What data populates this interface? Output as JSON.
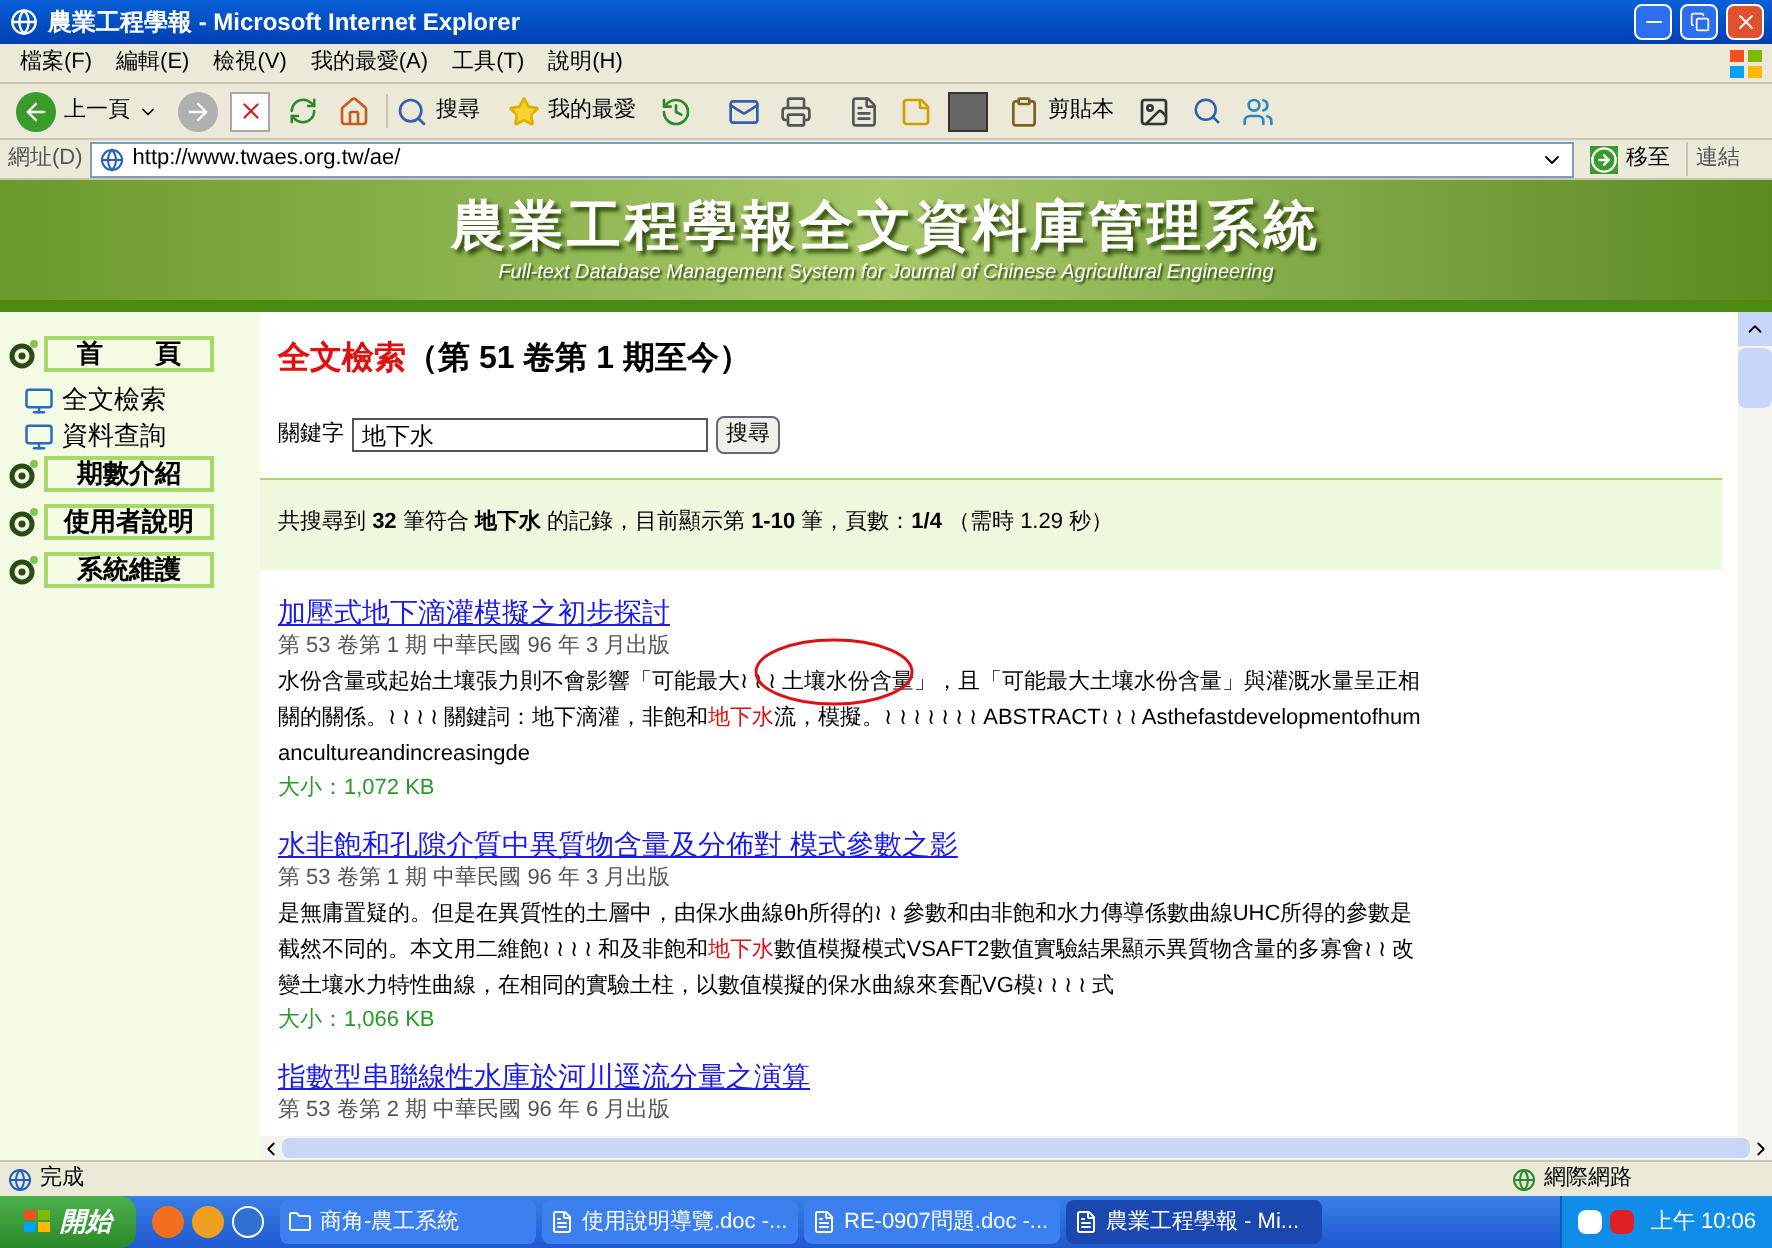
{
  "window": {
    "title": "農業工程學報 - Microsoft Internet Explorer"
  },
  "menu": [
    "檔案(F)",
    "編輯(E)",
    "檢視(V)",
    "我的最愛(A)",
    "工具(T)",
    "說明(H)"
  ],
  "toolbar": {
    "back": "上一頁",
    "search": "搜尋",
    "favorites": "我的最愛",
    "clipboard": "剪貼本"
  },
  "address_bar": {
    "label": "網址(D)",
    "url": "http://www.twaes.org.tw/ae/",
    "go": "移至",
    "links": "連結"
  },
  "banner": {
    "title": "農業工程學報全文資料庫管理系統",
    "subtitle": "Full-text Database Management System for Journal of Chinese Agricultural Engineering"
  },
  "sidebar": {
    "items": [
      {
        "kind": "section",
        "label": "首　　頁"
      },
      {
        "kind": "link",
        "label": "全文檢索"
      },
      {
        "kind": "link",
        "label": "資料查詢"
      },
      {
        "kind": "section",
        "label": "期數介紹"
      },
      {
        "kind": "section",
        "label": "使用者說明"
      },
      {
        "kind": "section",
        "label": "系統維護"
      }
    ]
  },
  "heading": {
    "highlight": "全文檢索",
    "rest": "（第 51 卷第 1 期至今）"
  },
  "search": {
    "label": "關鍵字",
    "value": "地下水",
    "button": "搜尋"
  },
  "summary": "共搜尋到 **32** 筆符合 **地下水** 的記錄，目前顯示第 **1-10** 筆，頁數：**1/4** （需時 1.29 秒）",
  "results": [
    {
      "title": "加壓式地下滴灌模擬之初步探討",
      "meta": "第 53 卷第 1 期 中華民國 96 年 3 月出版",
      "circled": true,
      "snippet": [
        {
          "text": "水份含量或起始土壤張力則不會影響「可能最大≀ ≀ ≀ 土壤水份含量」，且「可能最大土壤水份含量」與灌溉水量呈正相關的關係。≀ ≀ ≀ ≀ 關鍵詞：地下滴灌，非飽和",
          "highlight": false
        },
        {
          "text": "地下水",
          "highlight": true
        },
        {
          "text": "流，模擬。≀ ≀ ≀ ≀ ≀ ≀ ≀ ABSTRACT≀ ≀ ≀ Asthefastdevelopmentofhumancultureandincreasingde",
          "highlight": false
        }
      ],
      "size": "大小：1,072 KB"
    },
    {
      "title": "水非飽和孔隙介質中異質物含量及分佈對 模式參數之影",
      "meta": "第 53 卷第 1 期 中華民國 96 年 3 月出版",
      "circled": false,
      "snippet": [
        {
          "text": "是無庸置疑的。但是在異質性的土層中，由保水曲線θh所得的≀ ≀ 參數和由非飽和水力傳導係數曲線UHC所得的參數是截然不同的。本文用二維飽≀ ≀ ≀ ≀ 和及非飽和",
          "highlight": false
        },
        {
          "text": "地下水",
          "highlight": true
        },
        {
          "text": "數值模擬模式VSAFT2數值實驗結果顯示異質物含量的多寡會≀ ≀ 改變土壤水力特性曲線，在相同的實驗土柱，以數值模擬的保水曲線來套配VG模≀ ≀ ≀ ≀ 式",
          "highlight": false
        }
      ],
      "size": "大小：1,066 KB"
    },
    {
      "title": "指數型串聯線性水庫於河川逕流分量之演算",
      "meta": "第 53 卷第 2 期 中華民國 96 年 6 月出版",
      "circled": false
    }
  ],
  "status_bar": {
    "text": "完成",
    "zone": "網際網路"
  },
  "taskbar": {
    "start": "開始",
    "tasks": [
      {
        "label": "商角-農工系統",
        "selected": false
      },
      {
        "label": "使用說明導覽.doc -...",
        "selected": false
      },
      {
        "label": "RE-0907問題.doc -...",
        "selected": false
      },
      {
        "label": "農業工程學報 - Mi...",
        "selected": true
      }
    ],
    "clock": "上午 10:06"
  }
}
